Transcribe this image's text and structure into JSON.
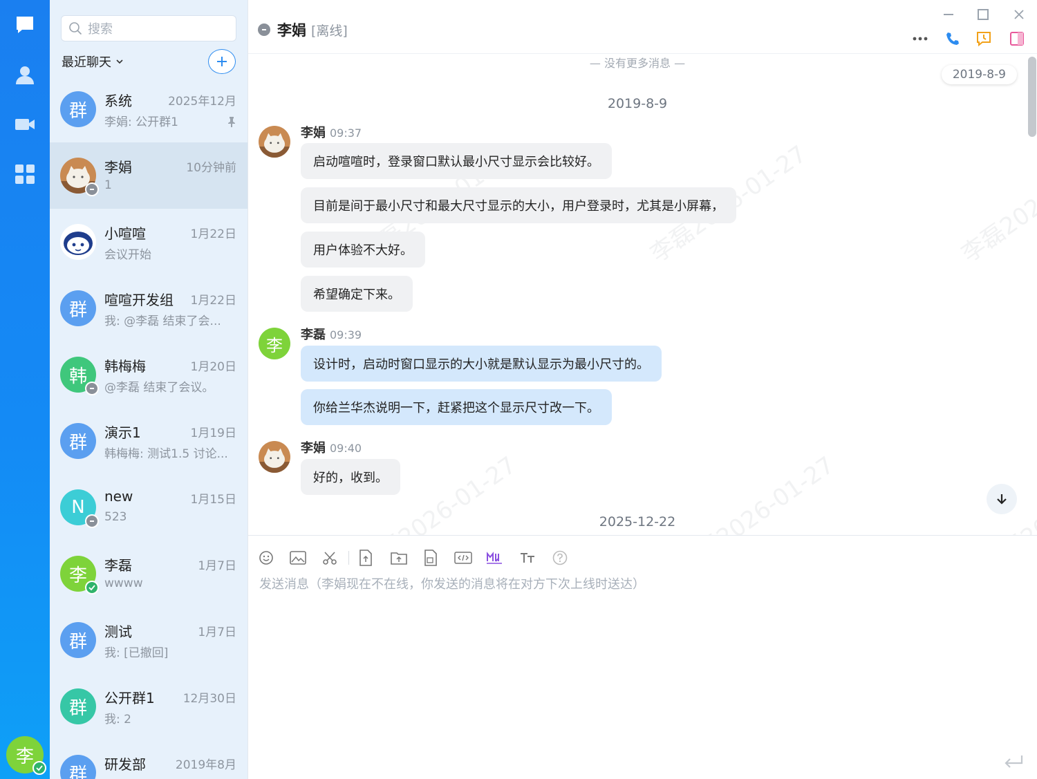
{
  "colors": {
    "accent": "#2d8cf0",
    "rail": "#1a7ff0",
    "group_avatar": "#5b9ff0",
    "teal": "#36c7a6",
    "green": "#7ed33a",
    "online": "#2fb36b",
    "offline": "#8a9099",
    "bubble_self": "#d4e8fc",
    "bubble_other": "#f0f1f3"
  },
  "rail": {
    "items": [
      {
        "icon": "chat-icon"
      },
      {
        "icon": "contacts-icon"
      },
      {
        "icon": "video-icon"
      },
      {
        "icon": "apps-grid-icon"
      }
    ],
    "user_avatar": "李"
  },
  "sidebar": {
    "search_placeholder": "搜索",
    "filter_label": "最近聊天",
    "conversations": [
      {
        "name": "系统",
        "time": "2025年12月",
        "preview": "李娟: 公开群1",
        "avatar": "群",
        "pinned": true
      },
      {
        "name": "李娟",
        "time": "10分钟前",
        "preview": "1",
        "avatar": "photo"
      },
      {
        "name": "小喧喧",
        "time": "1月22日",
        "preview": "会议开始",
        "avatar": "bot"
      },
      {
        "name": "喧喧开发组",
        "time": "1月22日",
        "preview": "我: @李磊 结束了会...",
        "avatar": "群"
      },
      {
        "name": "韩梅梅",
        "time": "1月20日",
        "preview": "@李磊 结束了会议。",
        "avatar": "韩"
      },
      {
        "name": "演示1",
        "time": "1月19日",
        "preview": "韩梅梅: 测试1.5 讨论...",
        "avatar": "群"
      },
      {
        "name": "new",
        "time": "1月15日",
        "preview": "523",
        "avatar": "N"
      },
      {
        "name": "李磊",
        "time": "1月7日",
        "preview": "wwww",
        "avatar": "李"
      },
      {
        "name": "测试",
        "time": "1月7日",
        "preview": "我: [已撤回]",
        "avatar": "群"
      },
      {
        "name": "公开群1",
        "time": "12月30日",
        "preview": "我: 2",
        "avatar": "群"
      },
      {
        "name": "研发部",
        "time": "2019年8月",
        "preview": "",
        "avatar": "群"
      }
    ]
  },
  "chat": {
    "contact_name": "李娟",
    "contact_state": "[离线]",
    "no_more": "— 没有更多消息 —",
    "date_chip": "2019-8-9",
    "date_1": "2019-8-9",
    "date_2": "2025-12-22",
    "watermark": "李磊2026-01-27",
    "groups": [
      {
        "sender": "李娟",
        "time": "09:37",
        "messages": [
          "启动喧喧时，登录窗口默认最小尺寸显示会比较好。",
          "目前是间于最小尺寸和最大尺寸显示的大小，用户登录时，尤其是小屏幕，",
          "用户体验不大好。",
          "希望确定下来。"
        ]
      },
      {
        "sender": "李磊",
        "avatar": "李",
        "time": "09:39",
        "messages": [
          "设计时，启动时窗口显示的大小就是默认显示为最小尺寸的。",
          "你给兰华杰说明一下，赶紧把这个显示尺寸改一下。"
        ]
      },
      {
        "sender": "李娟",
        "time": "09:40",
        "messages": [
          "好的，收到。"
        ]
      }
    ],
    "composer_placeholder": "发送消息（李娟现在不在线，你发送的消息将在对方下次上线时送达）"
  }
}
